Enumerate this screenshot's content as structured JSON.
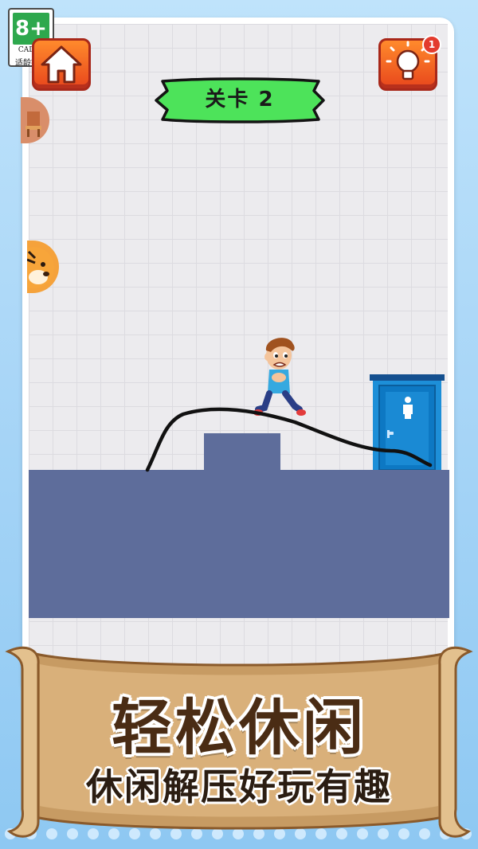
{
  "age_badge": {
    "age": "8+",
    "org": "CADPA",
    "tip": "适龄提示"
  },
  "hud": {
    "home_icon": "home-icon",
    "hint_icon": "lightbulb-icon",
    "hint_count": "1",
    "level_label": "关卡 2"
  },
  "scene": {
    "character": "boy-running",
    "goal": "restroom-door",
    "ground_color": "#5e6d9b",
    "line_color": "#111111"
  },
  "banner": {
    "title": "轻松休闲",
    "subtitle": "休闲解压好玩有趣"
  },
  "colors": {
    "accent_orange": "#e8461c",
    "level_green": "#4de35a",
    "door_blue": "#1d8fd8",
    "banner_text": "#4a2c14"
  }
}
